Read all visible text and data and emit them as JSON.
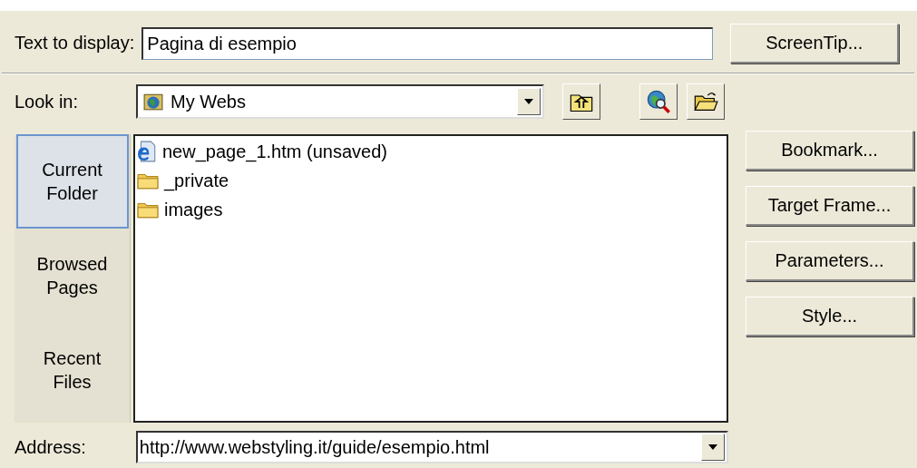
{
  "text_to_display": {
    "label": "Text to display:",
    "value": "Pagina di esempio"
  },
  "screentip_button": "ScreenTip...",
  "look_in": {
    "label": "Look in:",
    "value": "My Webs"
  },
  "places": [
    {
      "label": "Current Folder",
      "selected": true
    },
    {
      "label": "Browsed Pages",
      "selected": false
    },
    {
      "label": "Recent Files",
      "selected": false
    }
  ],
  "files": [
    {
      "kind": "page",
      "name": "new_page_1.htm (unsaved)"
    },
    {
      "kind": "folder",
      "name": "_private"
    },
    {
      "kind": "folder",
      "name": "images"
    }
  ],
  "address": {
    "label": "Address:",
    "value": "http://www.webstyling.it/guide/esempio.html"
  },
  "side_buttons": [
    "Bookmark...",
    "Target Frame...",
    "Parameters...",
    "Style..."
  ]
}
